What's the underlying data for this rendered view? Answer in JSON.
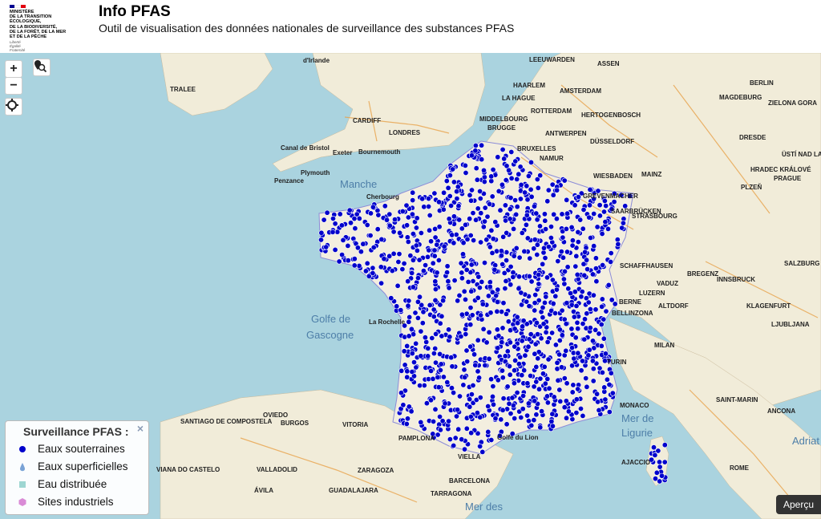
{
  "header": {
    "ministry_lines": "Ministère\nde la transition\nécologique,\nde la biodiversité,\nde la forêt, de la mer\net de la pêche",
    "motto": "Liberté\nÉgalité\nFraternité",
    "title": "Info PFAS",
    "subtitle": "Outil de visualisation des données nationales de surveillance des substances PFAS"
  },
  "controls": {
    "zoom_in": "+",
    "zoom_out": "−",
    "locate_icon": "crosshair-icon",
    "search_icon": "map-search-icon"
  },
  "legend": {
    "title": "Surveillance PFAS :",
    "close": "×",
    "items": [
      {
        "label": "Eaux souterraines",
        "color": "#0000cc",
        "symbol": "dot"
      },
      {
        "label": "Eaux superficielles",
        "color": "#7aa3d6",
        "symbol": "drop"
      },
      {
        "label": "Eau distribuée",
        "color": "#9ed6d2",
        "symbol": "square"
      },
      {
        "label": "Sites industriels",
        "color": "#d98bd6",
        "symbol": "hexagon"
      }
    ]
  },
  "apercu": "Aperçu",
  "seas": [
    "Manche",
    "Golfe de",
    "Gascogne",
    "Mer de",
    "Ligurie",
    "Mer des",
    "Adriat"
  ],
  "places": [
    "d'Irlande",
    "LEEUWARDEN",
    "ASSEN",
    "TRALEE",
    "HAARLEM",
    "AMSTERDAM",
    "BERLIN",
    "LA HAGUE",
    "MAGDEBURG",
    "ZIELONA GORA",
    "CARDIFF",
    "MIDDELBOURG",
    "ROTTERDAM",
    "BRUGGE",
    "HERTOGENBOSCH",
    "LONDRES",
    "ANTWERPEN",
    "DÜSSELDORF",
    "DRESDE",
    "BRUXELLES",
    "NAMUR",
    "ÜSTÍ NAD LABEM",
    "HRADEC KRÁLOVÉ",
    "WIESBADEN",
    "MAINZ",
    "PRAGUE",
    "GREVENMACHER",
    "SAARBRÜCKEN",
    "PLZEŇ",
    "STRASBOURG",
    "SCHAFFHAUSEN",
    "VADUZ",
    "SALZBURG",
    "BREGENZ",
    "INNSBRUCK",
    "LUZERN",
    "BERNE",
    "ALTDORF",
    "BELLINZONA",
    "KLAGENFURT",
    "MILAN",
    "LJUBLJANA",
    "TURIN",
    "MONACO",
    "SAINT-MARIN",
    "ANCONA",
    "SANTIAGO DE COMPOSTELA",
    "OVIEDO",
    "BURGOS",
    "VITORIA",
    "PAMPLONA",
    "VIELLA",
    "VIANA DO CASTELO",
    "VALLADOLID",
    "ZARAGOZA",
    "BARCELONA",
    "AJACCIO",
    "ROME",
    "ÁVILA",
    "GUADALAJARA",
    "TARRAGONA",
    "Penzance",
    "Plymouth",
    "Exeter",
    "Bournemouth",
    "Cherbourg",
    "La Rochelle",
    "Canal de Bristol",
    "Golfe du Lion"
  ],
  "colors": {
    "water": "#aad3df",
    "land": "#f1ecd9",
    "groundwater": "#0000cc"
  }
}
